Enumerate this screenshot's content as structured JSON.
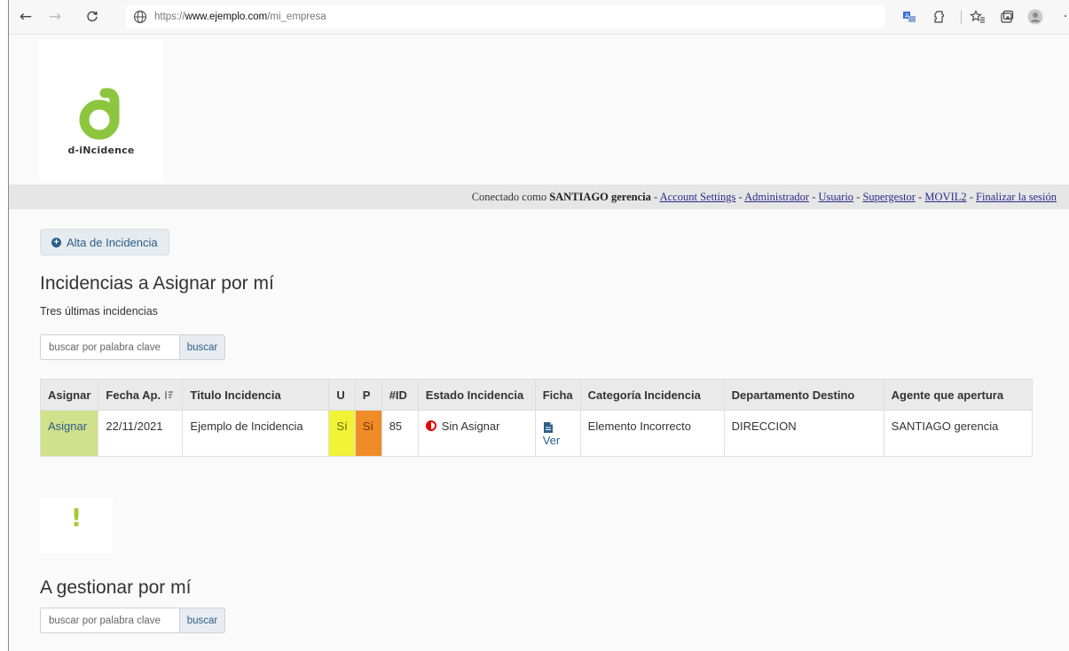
{
  "browser": {
    "url_prefix": "https://",
    "url_host": "www.ejemplo.com",
    "url_path": "/mi_empresa",
    "icons": [
      "back-arrow-icon",
      "forward-arrow-icon",
      "reload-icon",
      "globe-icon",
      "translate-icon",
      "extension-icon",
      "favorites-icon",
      "collections-icon",
      "profile-icon"
    ]
  },
  "logo": {
    "text": "d-iNcidence",
    "letter": "d",
    "color": "#8cc63f"
  },
  "userbar": {
    "prefix": "Conectado como ",
    "user": "SANTIAGO gerencia",
    "sep": " - ",
    "links": [
      "Account Settings",
      "Administrador",
      "Usuario",
      "Supergestor",
      "MOVIL2",
      "Finalizar la sesión"
    ]
  },
  "alta_button": {
    "label": "Alta de Incidencia"
  },
  "section1": {
    "title": "Incidencias a Asignar por mí",
    "subtitle": "Tres últimas incidencias",
    "search_placeholder": "buscar por palabra clave",
    "search_button": "buscar"
  },
  "table": {
    "headers": [
      "Asignar",
      "Fecha Ap.",
      "Titulo Incidencia",
      "U",
      "P",
      "#ID",
      "Estado Incidencia",
      "Ficha",
      "Categoría Incidencia",
      "Departamento Destino",
      "Agente que apertura"
    ],
    "rows": [
      {
        "asignar": "Asignar",
        "fecha": "22/11/2021",
        "titulo": "Ejemplo de Incidencia",
        "u": "Sí",
        "p": "Sí",
        "id": "85",
        "estado": "Sin Asignar",
        "ficha": "Ver",
        "categoria": "Elemento Incorrecto",
        "departamento": "DIRECCION",
        "agente": "SANTIAGO gerencia"
      }
    ],
    "colors": {
      "asignar": "#d1e08a",
      "u": "#f2f237",
      "p": "#f08c27",
      "estado_icon": "#e00000"
    }
  },
  "alert": {
    "symbol": "!"
  },
  "section2": {
    "title": "A gestionar por mí",
    "search_placeholder": "buscar por palabra clave",
    "search_button": "buscar"
  }
}
